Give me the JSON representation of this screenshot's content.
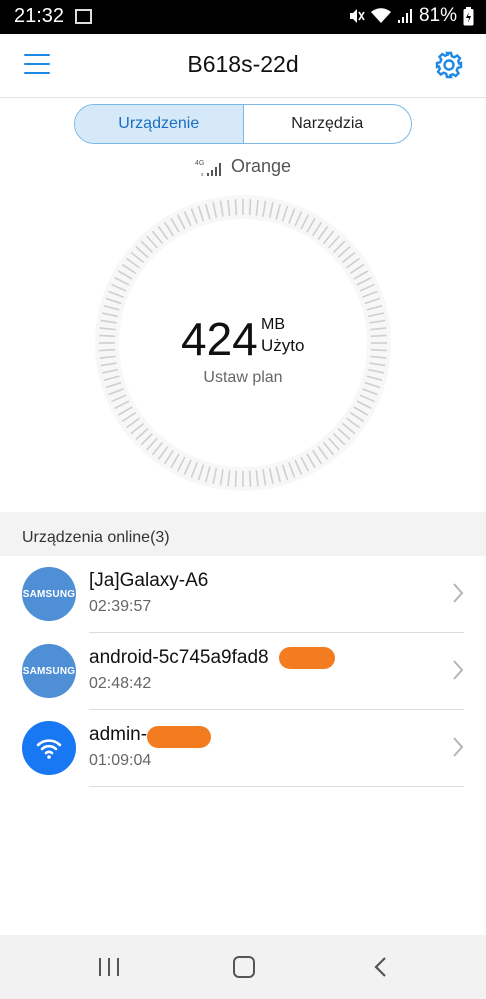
{
  "status_bar": {
    "time": "21:32",
    "battery": "81%"
  },
  "app_bar": {
    "title": "B618s-22d"
  },
  "tabs": [
    {
      "label": "Urządzenie",
      "active": true
    },
    {
      "label": "Narzędzia",
      "active": false
    }
  ],
  "network": {
    "type": "4G",
    "carrier": "Orange"
  },
  "usage": {
    "value": "424",
    "unit": "MB",
    "label": "Użyto",
    "plan_link": "Ustaw plan"
  },
  "online_devices": {
    "header": "Urządzenia online(3)",
    "items": [
      {
        "avatar": "SAMSUNG",
        "icon": "samsung-logo",
        "name": "[Ja]Galaxy-A6",
        "time": "02:39:57"
      },
      {
        "avatar": "SAMSUNG",
        "icon": "samsung-logo",
        "name": "android-5c745a9fad8",
        "time": "02:48:42"
      },
      {
        "avatar": "",
        "icon": "wifi-icon",
        "name": "admin-",
        "time": "01:09:04"
      }
    ]
  },
  "colors": {
    "accent": "#1e88e5",
    "redaction": "#f47c20",
    "samsung_avatar": "#4f8fd6",
    "wifi_avatar": "#1877f2"
  }
}
